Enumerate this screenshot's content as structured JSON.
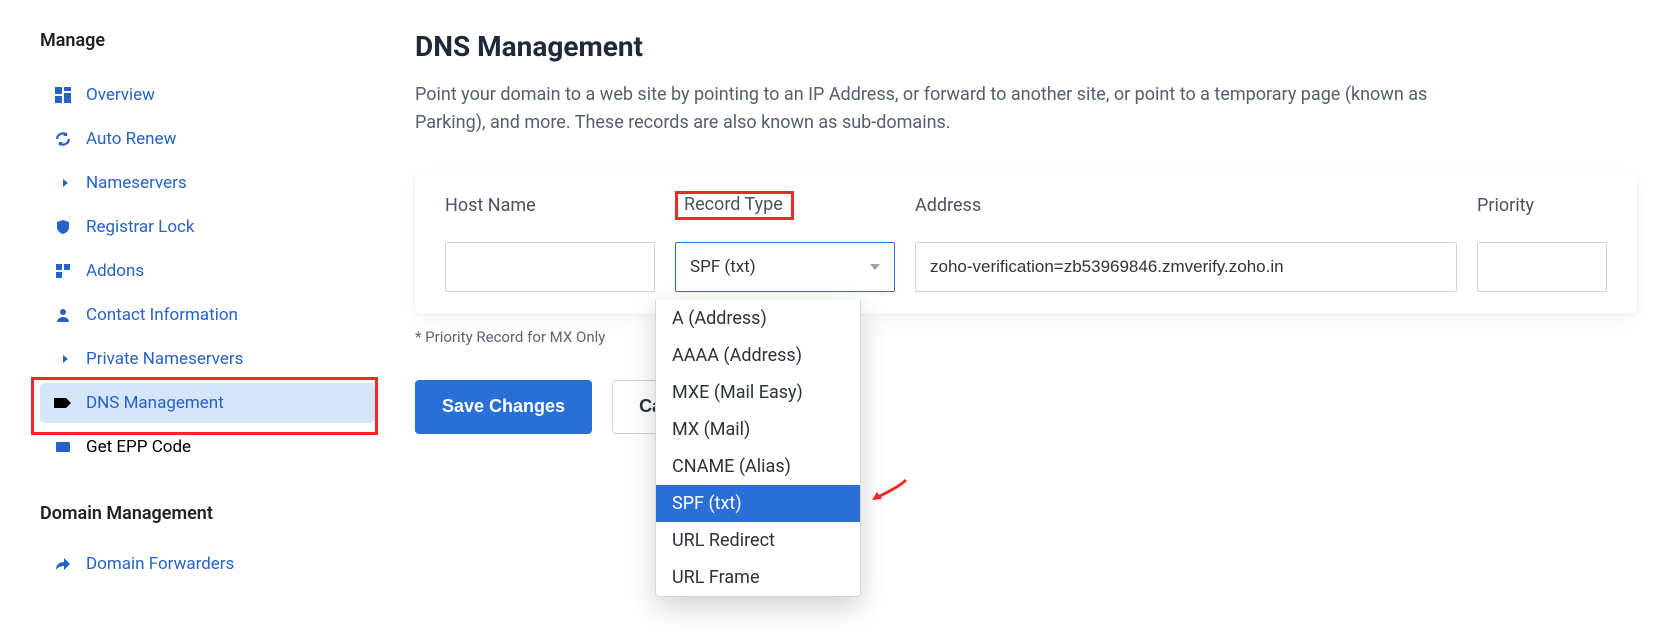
{
  "sidebar": {
    "heading": "Manage",
    "items": [
      {
        "icon": "dashboard-icon",
        "label": "Overview"
      },
      {
        "icon": "renew-icon",
        "label": "Auto Renew"
      },
      {
        "icon": "arrow-icon",
        "label": "Nameservers"
      },
      {
        "icon": "shield-icon",
        "label": "Registrar Lock"
      },
      {
        "icon": "addons-icon",
        "label": "Addons"
      },
      {
        "icon": "user-icon",
        "label": "Contact Information"
      },
      {
        "icon": "arrow-icon",
        "label": "Private Nameservers"
      },
      {
        "icon": "tag-icon",
        "label": "DNS Management"
      },
      {
        "icon": "epp-icon",
        "label": "Get EPP Code"
      }
    ],
    "heading2": "Domain Management",
    "items2": [
      {
        "icon": "forward-icon",
        "label": "Domain Forwarders"
      }
    ]
  },
  "page": {
    "title": "DNS Management",
    "subtitle": "Point your domain to a web site by pointing to an IP Address, or forward to another site, or point to a temporary page (known as Parking), and more. These records are also known as sub-domains."
  },
  "table": {
    "headers": {
      "host": "Host Name",
      "type": "Record Type",
      "address": "Address",
      "priority": "Priority"
    },
    "row": {
      "host_value": "",
      "type_value": "SPF (txt)",
      "address_value": "zoho-verification=zb53969846.zmverify.zoho.in",
      "priority_value": ""
    },
    "note": "* Priority Record for MX Only"
  },
  "dropdown": {
    "options": [
      "A (Address)",
      "AAAA (Address)",
      "MXE (Mail Easy)",
      "MX (Mail)",
      "CNAME (Alias)",
      "SPF (txt)",
      "URL Redirect",
      "URL Frame"
    ],
    "selected": "SPF (txt)"
  },
  "buttons": {
    "save": "Save Changes",
    "cancel": "Cancel"
  },
  "colors": {
    "primary": "#2a6fd6",
    "sidebar_active_bg": "#d6e6fa",
    "highlight": "#f02828"
  }
}
